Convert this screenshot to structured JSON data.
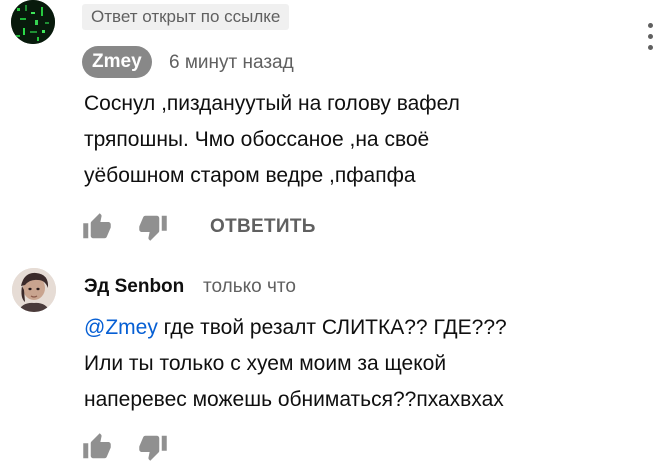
{
  "comment1": {
    "opened_label": "Ответ открыт по ссылке",
    "author": "Zmey",
    "time": "6 минут назад",
    "lines": [
      "Соснул ,пиздануутый на голову вафел",
      "тряпошны. Чмо обоссаное ,на своё",
      "уёбошном старом ведре ,пфапфа"
    ],
    "reply_label": "ОТВЕТИТЬ"
  },
  "comment2": {
    "author": "Эд Senbon",
    "time": "только что",
    "mention": "@Zmey",
    "line1_rest": " где твой резалт СЛИТКА?? ГДЕ???",
    "lines": [
      "Или ты только с хуем моим  за щекой",
      "наперевес можешь обниматься??пхахвхах"
    ]
  },
  "icons": {
    "like": "thumb-up-icon",
    "dislike": "thumb-down-icon",
    "more": "more-vertical-icon"
  },
  "colors": {
    "muted_text": "#606060",
    "link": "#065fd4",
    "author_chip": "#888888",
    "badge_bg": "#f0f0f0"
  }
}
